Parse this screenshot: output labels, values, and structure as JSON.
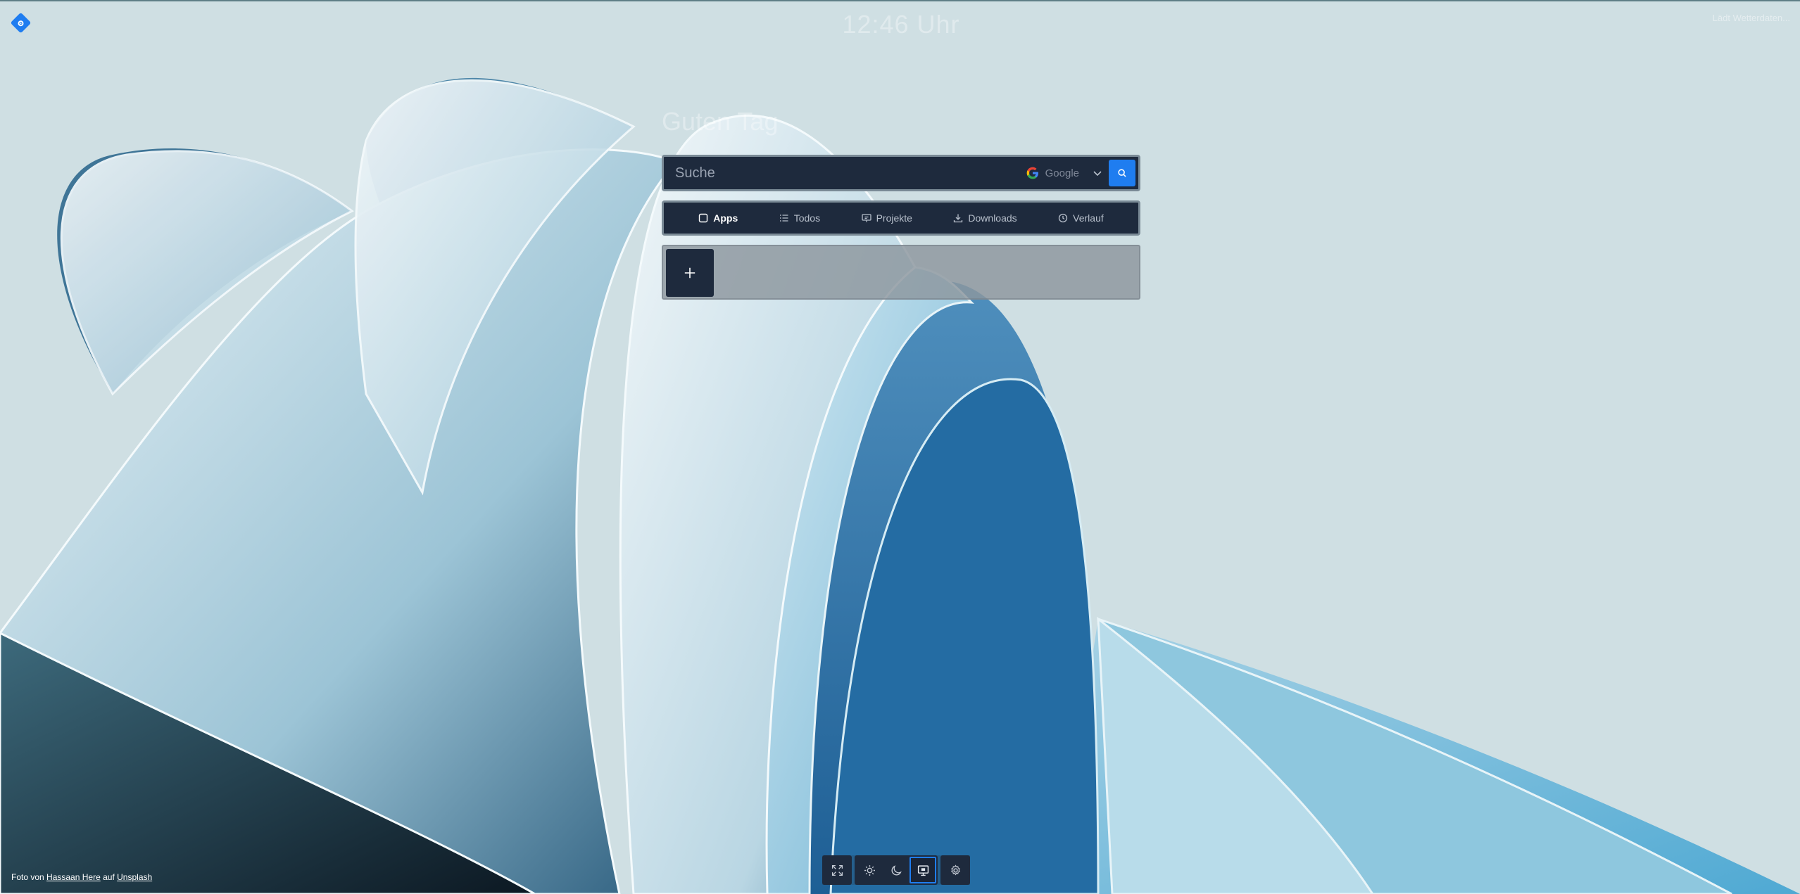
{
  "header": {
    "clock": "12:46 Uhr",
    "top_right": "Lädt Wetterdaten..."
  },
  "greeting": "Guten Tag",
  "search": {
    "placeholder": "Suche",
    "engine": "Google"
  },
  "tabs": [
    {
      "label": "Apps",
      "icon": "square-icon",
      "active": true
    },
    {
      "label": "Todos",
      "icon": "list-icon",
      "active": false
    },
    {
      "label": "Projekte",
      "icon": "presentation-icon",
      "active": false
    },
    {
      "label": "Downloads",
      "icon": "download-icon",
      "active": false
    },
    {
      "label": "Verlauf",
      "icon": "history-icon",
      "active": false
    }
  ],
  "apps": {
    "add_label": "+"
  },
  "toolbar": {
    "buttons": [
      {
        "icon": "fullscreen-icon"
      },
      {
        "icon": "sun-icon"
      },
      {
        "icon": "moon-icon"
      },
      {
        "icon": "monitor-icon",
        "active": true
      },
      {
        "icon": "gear-icon"
      }
    ]
  },
  "credits": {
    "prefix": "Foto von",
    "author": "Hassaan Here",
    "middle": "auf",
    "source": "Unsplash"
  },
  "colors": {
    "accent": "#1f7df0",
    "panel": "#1e2a3d",
    "background": "#cfdfe3"
  }
}
